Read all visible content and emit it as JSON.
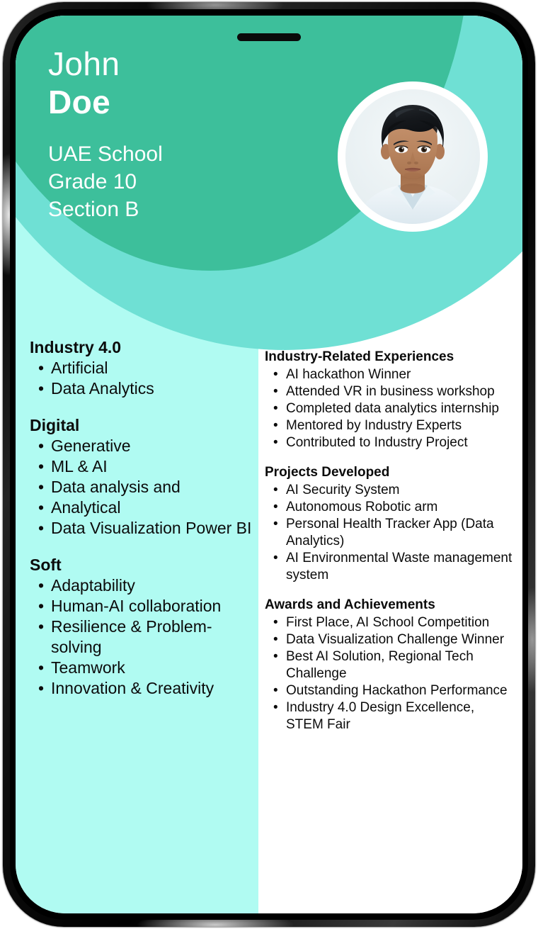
{
  "device": {
    "speaker_notch": "speaker-notch"
  },
  "header": {
    "first_name": "John",
    "last_name": "Doe",
    "school": "UAE School",
    "grade": "Grade 10",
    "section": "Section B",
    "portrait_alt": "student-portrait"
  },
  "colors": {
    "teal_dark": "#3dbf9b",
    "teal_mid": "#6fe0d4",
    "mint_light": "#b0fbf2",
    "text": "#0b0b0b",
    "header_text": "#ffffff"
  },
  "left_column": {
    "sections": [
      {
        "title": "Industry 4.0",
        "items": [
          "Artificial",
          "Data Analytics"
        ]
      },
      {
        "title": "Digital",
        "items": [
          "Generative",
          "ML & AI",
          "Data analysis and",
          "Analytical",
          "Data Visualization Power BI"
        ]
      },
      {
        "title": "Soft",
        "items": [
          "Adaptability",
          "Human-AI collaboration",
          "Resilience & Problem-solving",
          "Teamwork",
          "Innovation & Creativity"
        ]
      }
    ]
  },
  "right_column": {
    "sections": [
      {
        "title": "Industry-Related Experiences",
        "items": [
          "AI hackathon Winner",
          "Attended VR in business workshop",
          "Completed data analytics internship",
          "Mentored by Industry Experts",
          "Contributed to Industry Project"
        ]
      },
      {
        "title": "Projects Developed",
        "items": [
          "AI Security System",
          "Autonomous Robotic arm",
          "Personal Health Tracker App (Data Analytics)",
          "AI Environmental Waste management system"
        ]
      },
      {
        "title": "Awards and Achievements",
        "items": [
          "First Place, AI School Competition",
          "Data Visualization Challenge Winner",
          "Best AI Solution, Regional Tech Challenge",
          "Outstanding Hackathon Performance",
          "Industry 4.0 Design Excellence, STEM Fair"
        ]
      }
    ]
  }
}
